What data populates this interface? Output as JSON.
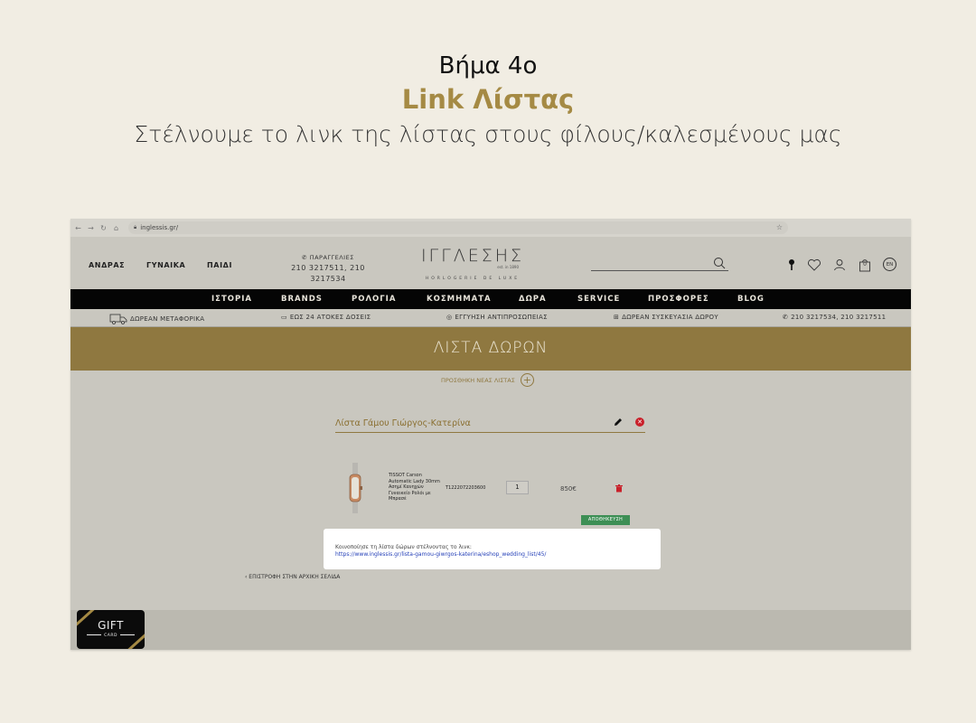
{
  "slide": {
    "step": "Βήμα 4ο",
    "title": "Link Λίστας",
    "description": "Στέλνουμε το λινκ της λίστας στους φίλους/καλεσμένους μας"
  },
  "browser": {
    "url": "inglessis.gr/"
  },
  "header": {
    "categories": [
      "ΑΝΔΡΑΣ",
      "ΓΥΝΑΙΚΑ",
      "ΠΑΙΔΙ"
    ],
    "orders_label": "ΠΑΡΑΓΓΕΛΙΕΣ",
    "orders_phones": "210 3217511, 210 3217534",
    "logo": "ΙΓΓΛΕΣΗΣ",
    "logo_est": "est. in 1890",
    "logo_sub": "HORLOGERIE DE LUXE",
    "cart_count": "0",
    "language": "EN"
  },
  "main_nav": [
    "ΙΣΤΟΡΙΑ",
    "BRANDS",
    "ΡΟΛΟΓΙΑ",
    "ΚΟΣΜΗΜΑΤΑ",
    "ΔΩΡΑ",
    "SERVICE",
    "ΠΡΟΣΦΟΡΕΣ",
    "BLOG"
  ],
  "info_bar": {
    "shipping": "ΔΩΡΕΑΝ ΜΕΤΑΦΟΡΙΚΑ",
    "installments": "ΕΩΣ 24 ΑΤΟΚΕΣ ΔΟΣΕΙΣ",
    "warranty": "ΕΓΓΥΗΣΗ ΑΝΤΙΠΡΟΣΩΠΕΙΑΣ",
    "gift_wrap": "ΔΩΡΕΑΝ ΣΥΣΚΕΥΑΣΙΑ ΔΩΡΟΥ",
    "phones": "210 3217534, 210 3217511"
  },
  "page": {
    "banner_title": "ΛΙΣΤΑ ΔΩΡΩΝ",
    "add_list_label": "ΠΡΟΣΘΗΚΗ ΝΕΑΣ ΛΙΣΤΑΣ",
    "list_name": "Λίστα Γάμου Γιώργος-Κατερίνα",
    "product": {
      "name": "TISSOT Carson Automatic Lady 30mm Ασημί Κανηχών Γυναικείο Ρολόι με Μπρασέ",
      "code": "T1222072203600",
      "quantity": "1",
      "price": "850€"
    },
    "save_button": "ΑΠΟΘΗΚΕΥΣΗ",
    "share_label": "Κοινοποίησε τη λίστα δώρων στέλνοντας το λινκ:",
    "share_url": "https://www.inglessis.gr/lista-gamou-giwrgos-katerina/eshop_wedding_list/45/",
    "back_link": "‹ ΕΠΙΣΤΡΟΦΗ ΣΤΗΝ ΑΡΧΙΚΗ ΣΕΛΙΔΑ"
  },
  "gift_card": {
    "title": "GIFT",
    "sub": "CARD"
  },
  "colors": {
    "background": "#f1ede3",
    "accent_gold": "#a58a44",
    "banner": "#8f7840",
    "nav_bg": "#050505",
    "save_green": "#3d8f55",
    "link_blue": "#2540b8"
  }
}
